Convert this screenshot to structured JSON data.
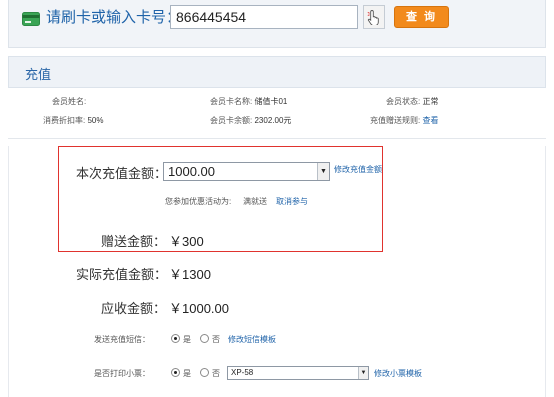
{
  "header": {
    "swipe_label": "请刷卡或输入卡号：",
    "card_number": "866445454",
    "query_label": "查 询"
  },
  "section": {
    "title": "充值"
  },
  "member": {
    "name_label": "会员姓名:",
    "name_value": "",
    "card_name_label": "会员卡名称:",
    "card_name_value": "储值卡01",
    "status_label": "会员状态:",
    "status_value": "正常",
    "discount_label": "消费折扣率:",
    "discount_value": "50%",
    "balance_label": "会员卡余额:",
    "balance_value": "2302.00元",
    "gift_rule_label": "充值赠送规则:",
    "gift_rule_link": "查看"
  },
  "recharge": {
    "amount_label": "本次充值金额：",
    "amount_value": "1000.00",
    "modify_amount_link": "修改充值金额",
    "promo_text": "您参加优惠活动为:",
    "promo_name": "满就送",
    "cancel_link": "取消参与",
    "gift_label": "赠送金额：",
    "gift_value": "￥300",
    "actual_label": "实际充值金额：",
    "actual_value": "￥1300",
    "receivable_label": "应收金额：",
    "receivable_value": "￥1000.00"
  },
  "sms": {
    "label": "发送充值短信：",
    "yes": "是",
    "no": "否",
    "selected": "yes",
    "template_link": "修改短信模板"
  },
  "receipt": {
    "label": "是否打印小票：",
    "yes": "是",
    "no": "否",
    "selected": "yes",
    "printer_value": "XP-58",
    "template_link": "修改小票模板"
  },
  "colors": {
    "accent_blue": "#1f63a9",
    "query_orange": "#f28a1c",
    "highlight_red": "#e0332e"
  },
  "icons": {
    "card": "card-icon",
    "swipe": "hand-pointer-icon",
    "dropdown": "chevron-down-icon"
  }
}
